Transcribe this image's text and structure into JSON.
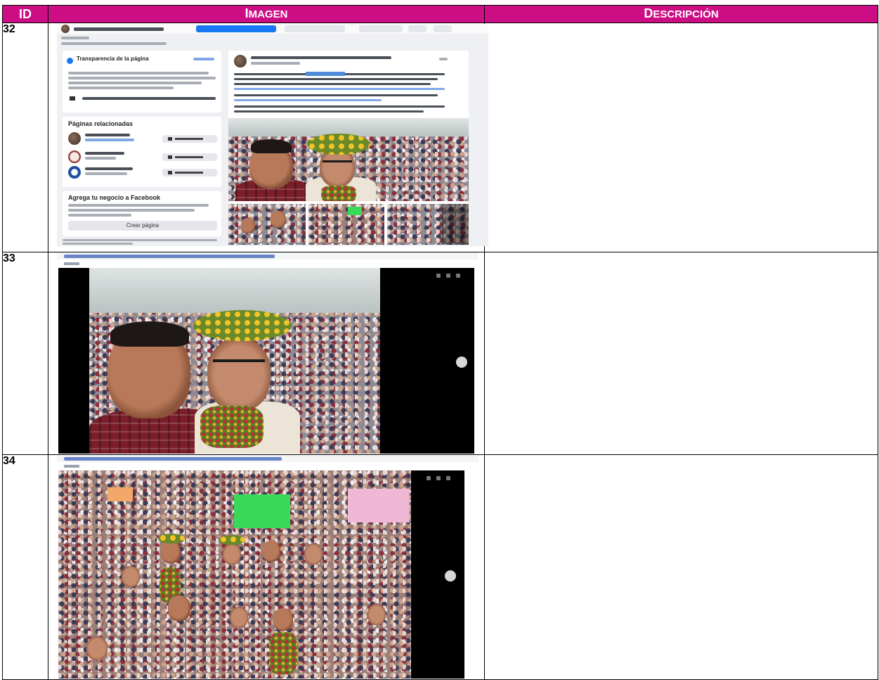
{
  "table": {
    "headers": {
      "id": "ID",
      "image_first": "I",
      "image_rest": "MAGEN",
      "description_first": "D",
      "description_rest": "ESCRIPCIÓN"
    },
    "rows": [
      {
        "id": "32",
        "description": ""
      },
      {
        "id": "33",
        "description": ""
      },
      {
        "id": "34",
        "description": ""
      }
    ]
  },
  "row32_capture": {
    "sidebar": {
      "transparency_heading": "Transparencia de la página",
      "related_heading": "Páginas relacionadas",
      "business_heading": "Agrega tu negocio a Facebook",
      "create_button": "Crear página"
    }
  },
  "colors": {
    "header_bg": "#cc0d84",
    "header_text": "#ffffff",
    "facebook_blue": "#1877f2"
  }
}
